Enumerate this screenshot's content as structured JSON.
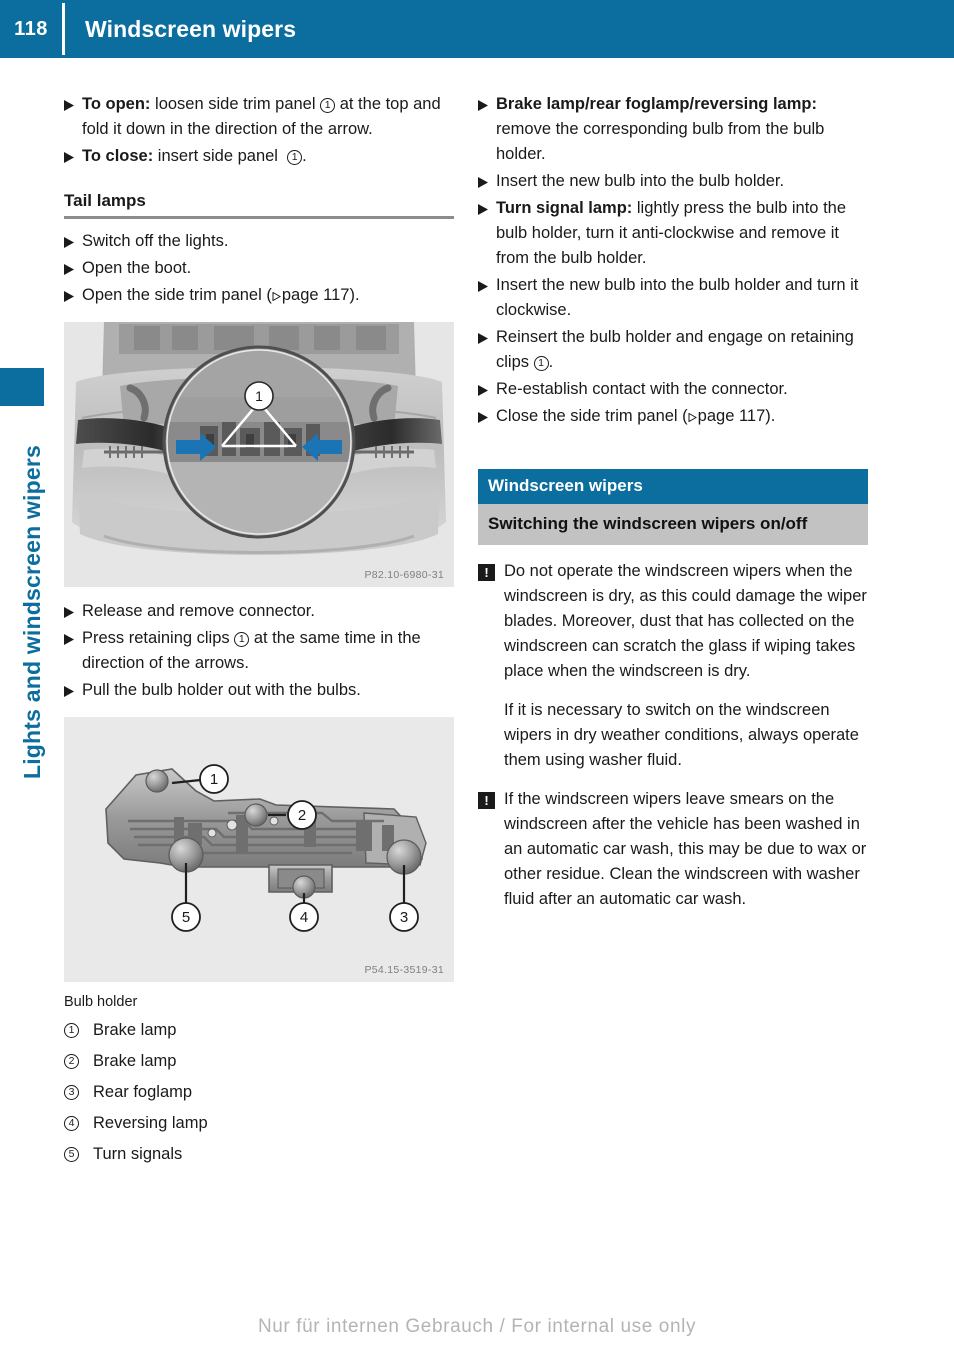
{
  "header": {
    "page_number": "118",
    "title": "Windscreen wipers"
  },
  "sidebar": {
    "chapter_label": "Lights and windscreen wipers"
  },
  "left_column": {
    "steps_top": [
      {
        "bold": "To open:",
        "text": " loosen side trim panel ",
        "ref": "1",
        "text_after": " at the top and fold it down in the direction of the arrow."
      },
      {
        "bold": "To close:",
        "text": " insert side panel ",
        "ref": "1",
        "text_after": "."
      }
    ],
    "section_heading": "Tail lamps",
    "steps_tail": [
      {
        "text": "Switch off the lights."
      },
      {
        "text": "Open the boot."
      },
      {
        "text": "Open the side trim panel (",
        "pageref": "page 117",
        "text_after": ")."
      }
    ],
    "figure_1": {
      "code": "P82.10-6980-31",
      "alt": "Rear of vehicle with magnified detail of bulb holder retaining clips and direction arrows",
      "callout": "1"
    },
    "steps_mid": [
      {
        "text": "Release and remove connector."
      },
      {
        "text": "Press retaining clips ",
        "ref": "1",
        "text_after": " at the same time in the direction of the arrows."
      },
      {
        "text": "Pull the bulb holder out with the bulbs."
      }
    ],
    "figure_2": {
      "code": "P54.15-3519-31",
      "alt": "Bulb holder with numbered bulb positions 1 to 5"
    },
    "legend_title": "Bulb holder",
    "legend": [
      {
        "num": "1",
        "label": "Brake lamp"
      },
      {
        "num": "2",
        "label": "Brake lamp"
      },
      {
        "num": "3",
        "label": "Rear foglamp"
      },
      {
        "num": "4",
        "label": "Reversing lamp"
      },
      {
        "num": "5",
        "label": "Turn signals"
      }
    ]
  },
  "right_column": {
    "steps": [
      {
        "bold": "Brake lamp/rear foglamp/reversing lamp:",
        "text": " remove the corresponding bulb from the bulb holder."
      },
      {
        "text": "Insert the new bulb into the bulb holder."
      },
      {
        "bold": "Turn signal lamp:",
        "text": " lightly press the bulb into the bulb holder, turn it anti-clockwise and remove it from the bulb holder."
      },
      {
        "text": "Insert the new bulb into the bulb holder and turn it clockwise."
      },
      {
        "text": "Reinsert the bulb holder and engage on retaining clips ",
        "ref": "1",
        "text_after": "."
      },
      {
        "text": "Re-establish contact with the connector."
      },
      {
        "text": "Close the side trim panel (",
        "pageref": "page 117",
        "text_after": ")."
      }
    ],
    "panel": {
      "head": "Windscreen wipers",
      "sub": "Switching the windscreen wipers on/off",
      "notes": [
        {
          "icon": "!",
          "text": "Do not operate the windscreen wipers when the windscreen is dry, as this could damage the wiper blades. Moreover, dust that has collected on the windscreen can scratch the glass if wiping takes place when the windscreen is dry.",
          "para": "If it is necessary to switch on the windscreen wipers in dry weather conditions, always operate them using washer fluid."
        },
        {
          "icon": "!",
          "text": "If the windscreen wipers leave smears on the windscreen after the vehicle has been washed in an automatic car wash, this may be due to wax or other residue. Clean the windscreen with washer fluid after an automatic car wash."
        }
      ]
    }
  },
  "footer": {
    "text": "Nur für internen Gebrauch / For internal use only"
  },
  "colors": {
    "brand_blue": "#0c6e9e",
    "panel_gray": "#c2c2c2",
    "rule_gray": "#8c8c8c",
    "figure_bg": "#e6e6e6"
  }
}
